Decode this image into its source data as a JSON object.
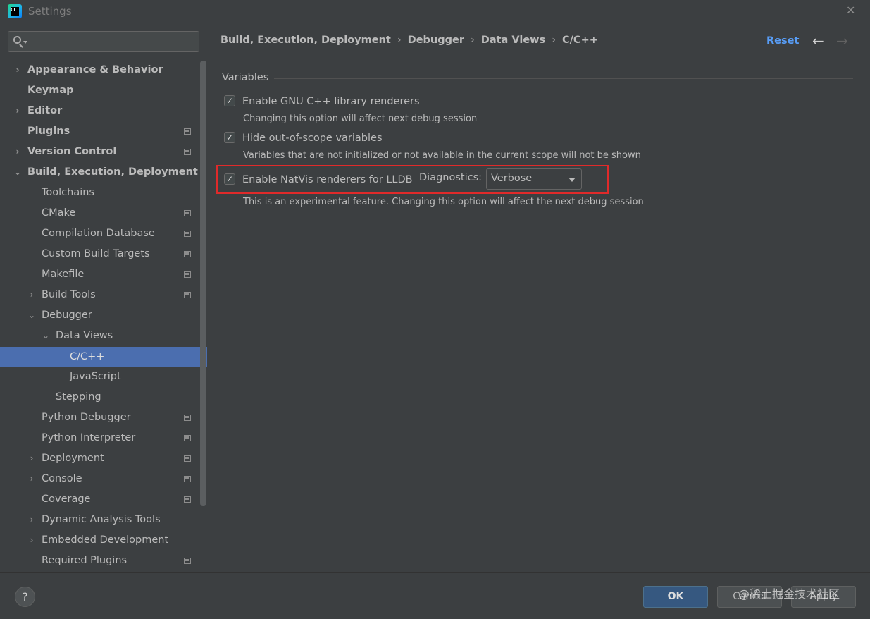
{
  "window": {
    "title": "Settings",
    "app_icon_text": "CL"
  },
  "sidebar": {
    "search": {
      "value": "",
      "placeholder": ""
    },
    "items": [
      {
        "label": "Appearance & Behavior",
        "bold": true,
        "chevron": "›"
      },
      {
        "label": "Keymap",
        "bold": true,
        "chevron": ""
      },
      {
        "label": "Editor",
        "bold": true,
        "chevron": "›"
      },
      {
        "label": "Plugins",
        "bold": true,
        "chevron": ""
      },
      {
        "label": "Version Control",
        "bold": true,
        "chevron": "›"
      },
      {
        "label": "Build, Execution, Deployment",
        "bold": true,
        "chevron": "⌄"
      },
      {
        "label": "Toolchains",
        "chevron": ""
      },
      {
        "label": "CMake",
        "chevron": ""
      },
      {
        "label": "Compilation Database",
        "chevron": ""
      },
      {
        "label": "Custom Build Targets",
        "chevron": ""
      },
      {
        "label": "Makefile",
        "chevron": ""
      },
      {
        "label": "Build Tools",
        "chevron": "›"
      },
      {
        "label": "Debugger",
        "chevron": "⌄"
      },
      {
        "label": "Data Views",
        "chevron": "⌄"
      },
      {
        "label": "C/C++",
        "chevron": ""
      },
      {
        "label": "JavaScript",
        "chevron": ""
      },
      {
        "label": "Stepping",
        "chevron": ""
      },
      {
        "label": "Python Debugger",
        "chevron": ""
      },
      {
        "label": "Python Interpreter",
        "chevron": ""
      },
      {
        "label": "Deployment",
        "chevron": "›"
      },
      {
        "label": "Console",
        "chevron": "›"
      },
      {
        "label": "Coverage",
        "chevron": ""
      },
      {
        "label": "Dynamic Analysis Tools",
        "chevron": "›"
      },
      {
        "label": "Embedded Development",
        "chevron": "›"
      },
      {
        "label": "Required Plugins",
        "chevron": ""
      }
    ]
  },
  "header": {
    "breadcrumb": [
      "Build, Execution, Deployment",
      "Debugger",
      "Data Views",
      "C/C++"
    ],
    "separator": "›",
    "reset_label": "Reset",
    "back_arrow": "←",
    "forward_arrow": "→"
  },
  "variables": {
    "group_title": "Variables",
    "options": [
      {
        "label": "Enable GNU C++ library renderers",
        "checked": true,
        "check_mark": "✓",
        "note": "Changing this option will affect next debug session"
      },
      {
        "label": "Hide out-of-scope variables",
        "checked": true,
        "check_mark": "✓",
        "note": "Variables that are not initialized or not available in the current scope will not be shown"
      },
      {
        "label": "Enable NatVis renderers for LLDB",
        "checked": true,
        "check_mark": "✓",
        "note": "This is an experimental feature. Changing this option will affect the next debug session"
      }
    ],
    "diagnostics": {
      "label": "Diagnostics:",
      "value": "Verbose"
    },
    "highlight_color": "#e02a2a"
  },
  "footer": {
    "help_label": "?",
    "ok_label": "OK",
    "cancel_label": "Cancel",
    "apply_label": "Apply",
    "watermark": "@稀土掘金技术社区"
  },
  "colors": {
    "background": "#3c3f41",
    "selection": "#4b6eaf",
    "link": "#589df6",
    "ok_button": "#365880"
  }
}
